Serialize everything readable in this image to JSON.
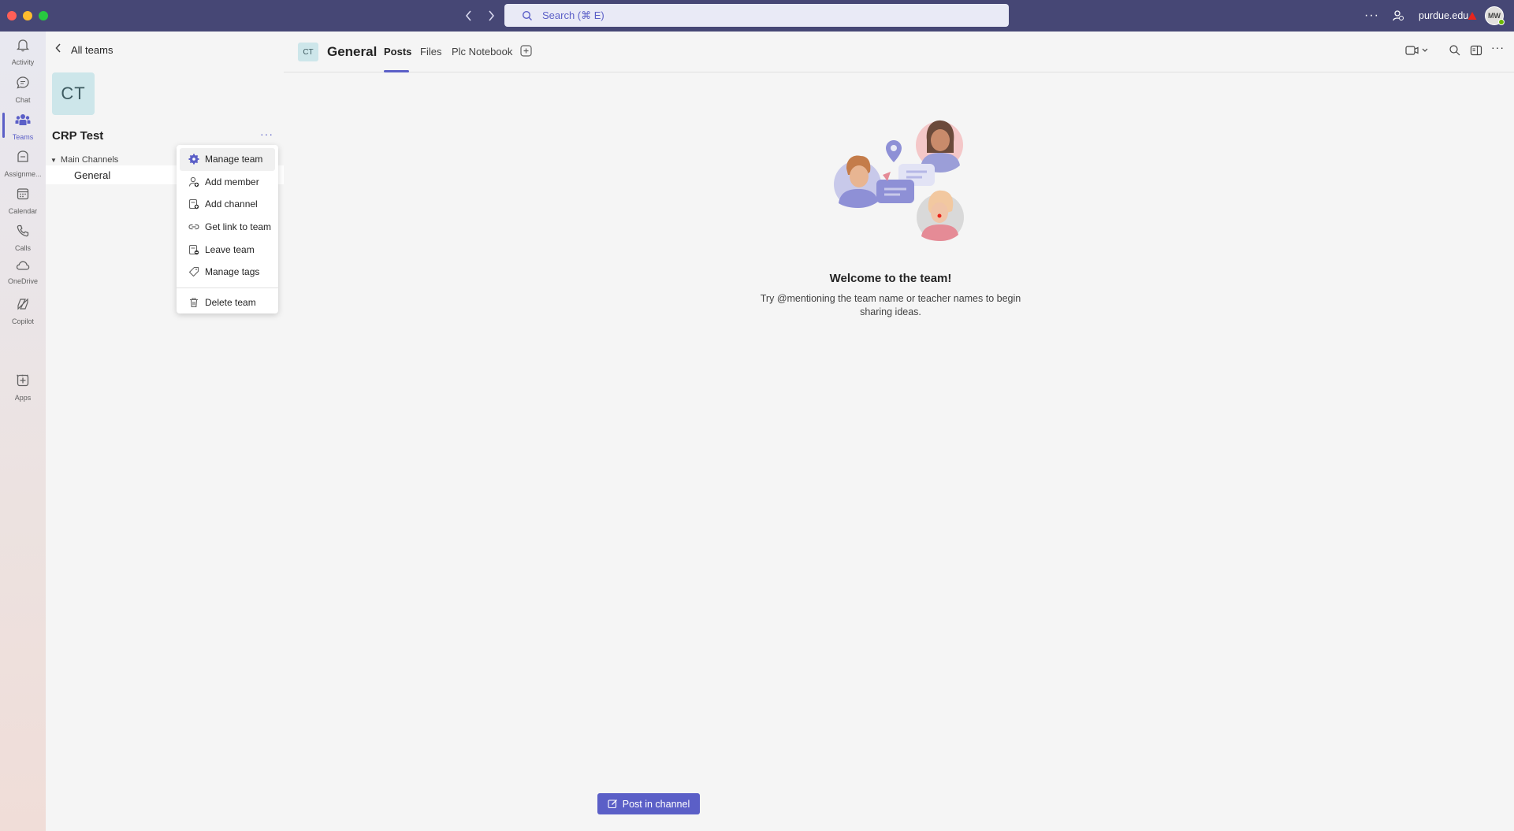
{
  "titlebar": {
    "search_placeholder": "Search (⌘ E)",
    "org_name": "purdue.edu",
    "avatar_initials": "MW",
    "more_label": "···"
  },
  "rail": {
    "items": [
      {
        "label": "Activity",
        "icon": "bell-icon"
      },
      {
        "label": "Chat",
        "icon": "chat-icon"
      },
      {
        "label": "Teams",
        "icon": "teams-icon"
      },
      {
        "label": "Assignme...",
        "icon": "assignments-icon"
      },
      {
        "label": "Calendar",
        "icon": "calendar-icon"
      },
      {
        "label": "Calls",
        "icon": "phone-icon"
      },
      {
        "label": "OneDrive",
        "icon": "cloud-icon"
      },
      {
        "label": "Copilot",
        "icon": "copilot-icon"
      },
      {
        "label": "Apps",
        "icon": "apps-icon"
      }
    ],
    "more_label": "···"
  },
  "team_panel": {
    "back_label": "All teams",
    "team_initials": "CT",
    "team_name": "CRP Test",
    "more_label": "···",
    "section_label": "Main Channels",
    "channel_label": "General"
  },
  "context_menu": {
    "items": [
      {
        "label": "Manage team",
        "icon": "gear-icon"
      },
      {
        "label": "Add member",
        "icon": "add-person-icon"
      },
      {
        "label": "Add channel",
        "icon": "add-channel-icon"
      },
      {
        "label": "Get link to team",
        "icon": "link-icon"
      },
      {
        "label": "Leave team",
        "icon": "leave-icon"
      },
      {
        "label": "Manage tags",
        "icon": "tag-icon"
      },
      {
        "label": "Delete team",
        "icon": "trash-icon"
      }
    ]
  },
  "main": {
    "channel_initials": "CT",
    "channel_title": "General",
    "tabs": [
      {
        "label": "Posts",
        "active": true
      },
      {
        "label": "Files",
        "active": false
      },
      {
        "label": "Plc Notebook",
        "active": false
      }
    ],
    "welcome_title": "Welcome to the team!",
    "welcome_subtitle": "Try @mentioning the team name or teacher names to begin sharing ideas.",
    "post_button": "Post in channel"
  },
  "colors": {
    "titlebar": "#464775",
    "accent": "#5b5fc7",
    "annotation_arrow": "#e8251d"
  }
}
